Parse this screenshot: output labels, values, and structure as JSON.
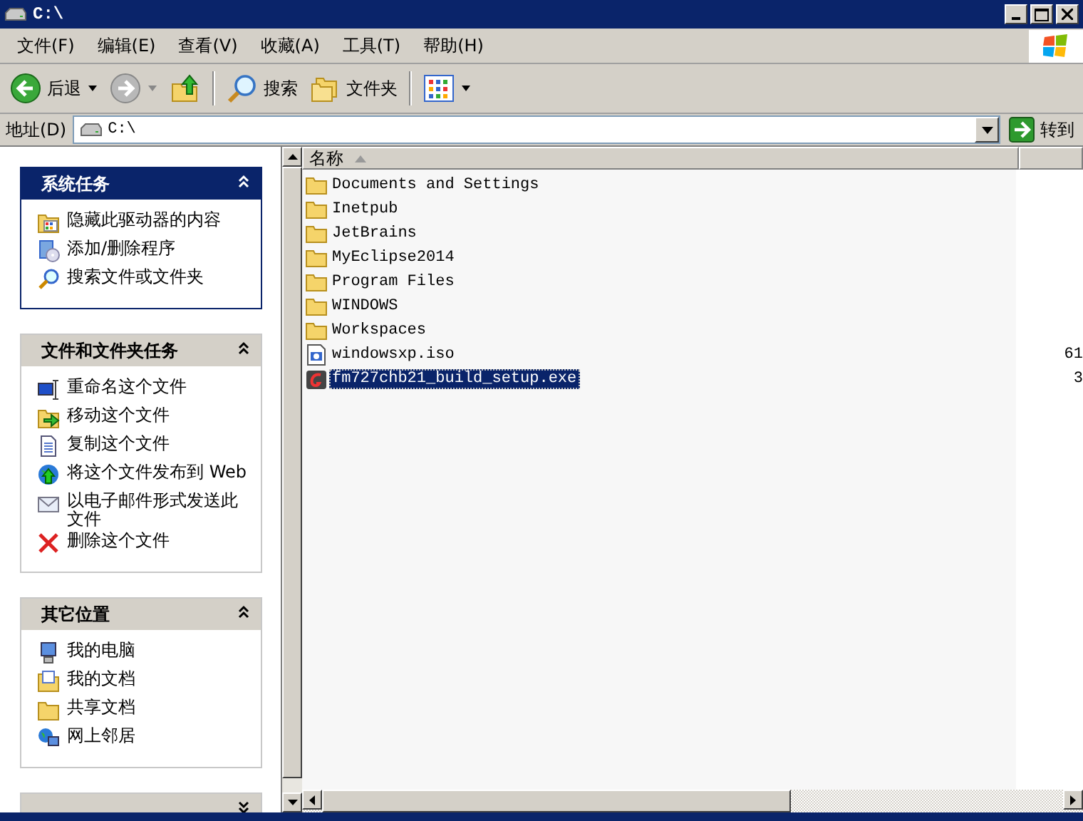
{
  "window": {
    "title": "C:\\"
  },
  "menu": [
    "文件(F)",
    "编辑(E)",
    "查看(V)",
    "收藏(A)",
    "工具(T)",
    "帮助(H)"
  ],
  "toolbar": {
    "back": "后退",
    "search": "搜索",
    "folders": "文件夹"
  },
  "address": {
    "label": "地址(D)",
    "value": "C:\\",
    "go": "转到"
  },
  "task_panels": [
    {
      "title": "系统任务",
      "kind": "primary",
      "expanded": true,
      "items": [
        "隐藏此驱动器的内容",
        "添加/删除程序",
        "搜索文件或文件夹"
      ]
    },
    {
      "title": "文件和文件夹任务",
      "kind": "normal",
      "expanded": true,
      "items": [
        "重命名这个文件",
        "移动这个文件",
        "复制这个文件",
        "将这个文件发布到 Web",
        "以电子邮件形式发送此文件",
        "删除这个文件"
      ]
    },
    {
      "title": "其它位置",
      "kind": "normal",
      "expanded": true,
      "items": [
        "我的电脑",
        "我的文档",
        "共享文档",
        "网上邻居"
      ]
    },
    {
      "kind": "normal",
      "expanded": false
    }
  ],
  "columns": [
    {
      "label": "名称"
    },
    {}
  ],
  "files": [
    {
      "name": "Documents and Settings",
      "kind": "folder",
      "selected": false
    },
    {
      "name": "Inetpub",
      "kind": "folder",
      "selected": false
    },
    {
      "name": "JetBrains",
      "kind": "folder",
      "selected": false
    },
    {
      "name": "MyEclipse2014",
      "kind": "folder",
      "selected": false
    },
    {
      "name": "Program Files",
      "kind": "folder",
      "selected": false
    },
    {
      "name": "WINDOWS",
      "kind": "folder",
      "selected": false
    },
    {
      "name": "Workspaces",
      "kind": "folder",
      "selected": false
    },
    {
      "name": "windowsxp.iso",
      "kind": "iso",
      "selected": false,
      "column_2": "61"
    },
    {
      "name": "fm727chb21_build_setup.exe",
      "kind": "exe",
      "selected": true,
      "column_2": "3"
    }
  ]
}
